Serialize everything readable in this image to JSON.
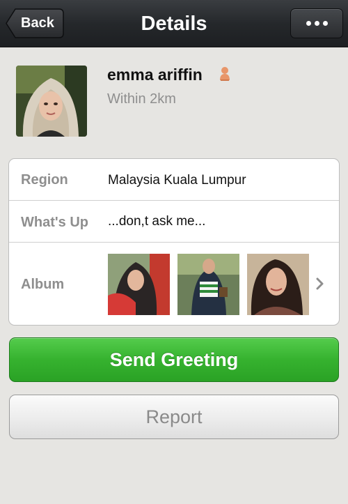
{
  "nav": {
    "back_label": "Back",
    "title": "Details",
    "more_icon": "more-dots-icon"
  },
  "profile": {
    "name": "emma ariffin",
    "gender_icon": "female-icon",
    "distance": "Within 2km"
  },
  "info": {
    "region_label": "Region",
    "region_value": "Malaysia Kuala Lumpur",
    "whatsup_label": "What's Up",
    "whatsup_value": "...don,t ask me...",
    "album_label": "Album"
  },
  "actions": {
    "send_label": "Send Greeting",
    "report_label": "Report"
  },
  "colors": {
    "nav_bg": "#25282b",
    "send_green": "#36b22f",
    "label_gray": "#8e8e8e",
    "female_icon": "#e8966a"
  }
}
